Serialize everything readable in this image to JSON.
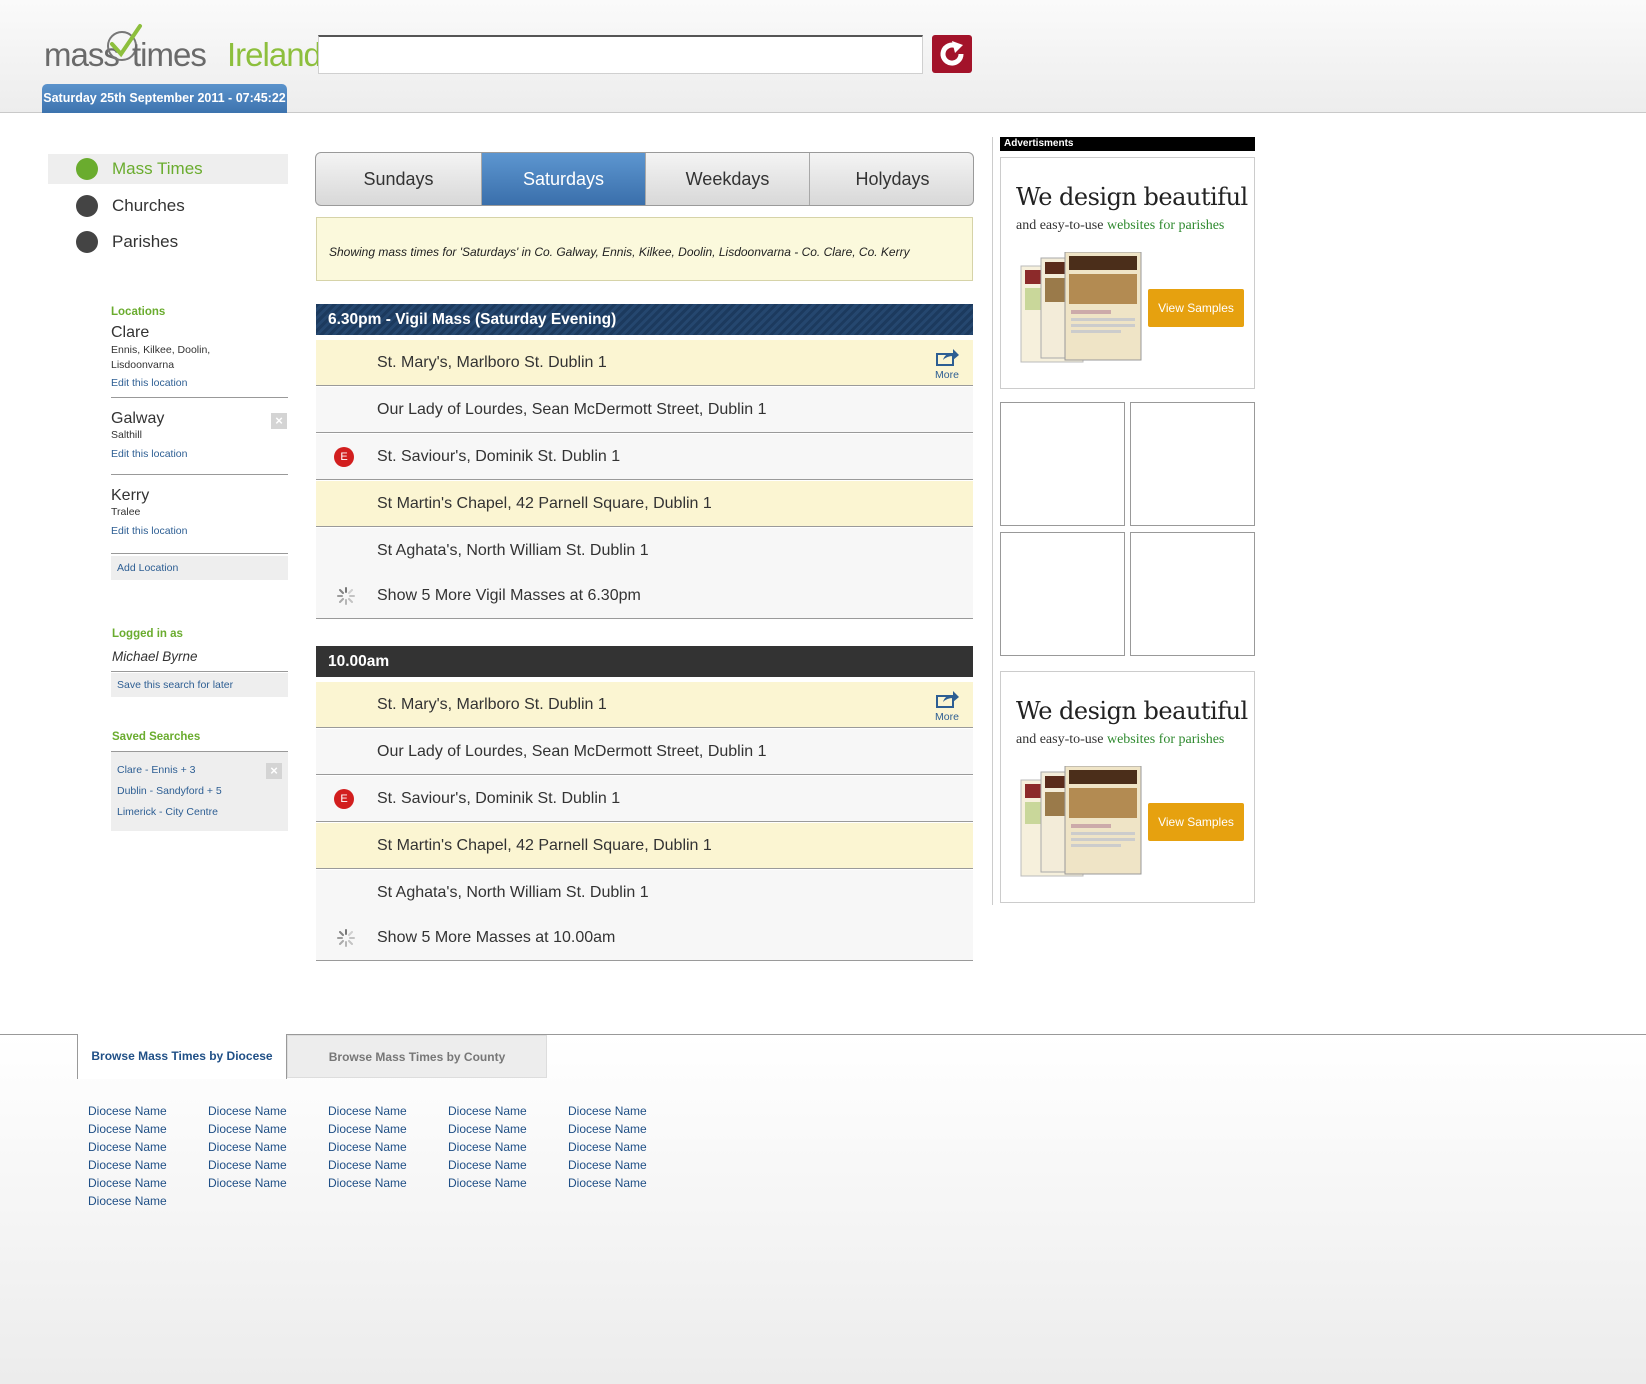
{
  "header": {
    "logo": {
      "part1": "mass",
      "part2": "times",
      "part3": "Ireland"
    },
    "datetime": "Saturday 25th September 2011 - 07:45:22",
    "search": {
      "value": "",
      "placeholder": ""
    },
    "search_button_icon": "refresh-icon",
    "colors": {
      "brand_green": "#8dbf3d",
      "search_button": "#a3132a",
      "date_bar": "#3d73ae"
    }
  },
  "nav": [
    {
      "label": "Mass Times",
      "icon": "tower-icon",
      "active": true
    },
    {
      "label": "Churches",
      "icon": "church-icon",
      "active": false
    },
    {
      "label": "Parishes",
      "icon": "parish-icon",
      "active": false
    }
  ],
  "sidebar": {
    "locations_heading": "Locations",
    "locations": [
      {
        "name": "Clare",
        "sub1": "Ennis, Kilkee, Doolin,",
        "sub2": "Lisdoonvarna",
        "edit": "Edit this location"
      },
      {
        "name": "Galway",
        "sub1": "Salthill",
        "edit": "Edit this location"
      },
      {
        "name": "Kerry",
        "sub1": "Tralee",
        "edit": "Edit this location"
      }
    ],
    "add_location": "Add Location",
    "logged_in_heading": "Logged in as",
    "user": "Michael Byrne",
    "save_search": "Save this search for later",
    "saved_heading": "Saved Searches",
    "saved": [
      "Clare - Ennis + 3",
      "Dublin - Sandyford + 5",
      "Limerick - City Centre"
    ]
  },
  "tabs": [
    {
      "label": "Sundays",
      "active": false
    },
    {
      "label": "Saturdays",
      "active": true
    },
    {
      "label": "Weekdays",
      "active": false
    },
    {
      "label": "Holydays",
      "active": false
    }
  ],
  "notice": "Showing mass times for 'Saturdays' in Co. Galway, Ennis, Kilkee, Doolin, Lisdoonvarna - Co. Clare, Co. Kerry",
  "sections": [
    {
      "heading": "6.30pm - Vigil Mass (Saturday Evening)",
      "rows": [
        "St. Mary's, Marlboro St. Dublin 1",
        "Our Lady of Lourdes, Sean McDermott Street, Dublin 1",
        "St. Saviour's, Dominik St. Dublin 1",
        "St Martin's Chapel, 42 Parnell Square, Dublin 1",
        "St Aghata's, North William St. Dublin 1"
      ],
      "more_label": "More",
      "badge": "E",
      "show_more": "Show 5 More Vigil Masses at  6.30pm"
    },
    {
      "heading": "10.00am",
      "rows": [
        "St. Mary's, Marlboro St. Dublin 1",
        "Our Lady of Lourdes, Sean McDermott Street, Dublin 1",
        "St. Saviour's, Dominik St. Dublin 1",
        "St Martin's Chapel, 42 Parnell Square, Dublin 1",
        "St Aghata's, North William St. Dublin 1"
      ],
      "more_label": "More",
      "badge": "E",
      "show_more": "Show 5 More Masses at 10.00am"
    }
  ],
  "ads": {
    "label": "Advertisments",
    "headline": "We design beautiful",
    "sub_prefix": "and easy-to-use ",
    "sub_highlight": "websites for parishes",
    "button": "View Samples"
  },
  "footer": {
    "tab_diocese": "Browse Mass Times by Diocese",
    "tab_county": "Browse Mass Times by County",
    "diocese_label": "Diocese Name"
  }
}
